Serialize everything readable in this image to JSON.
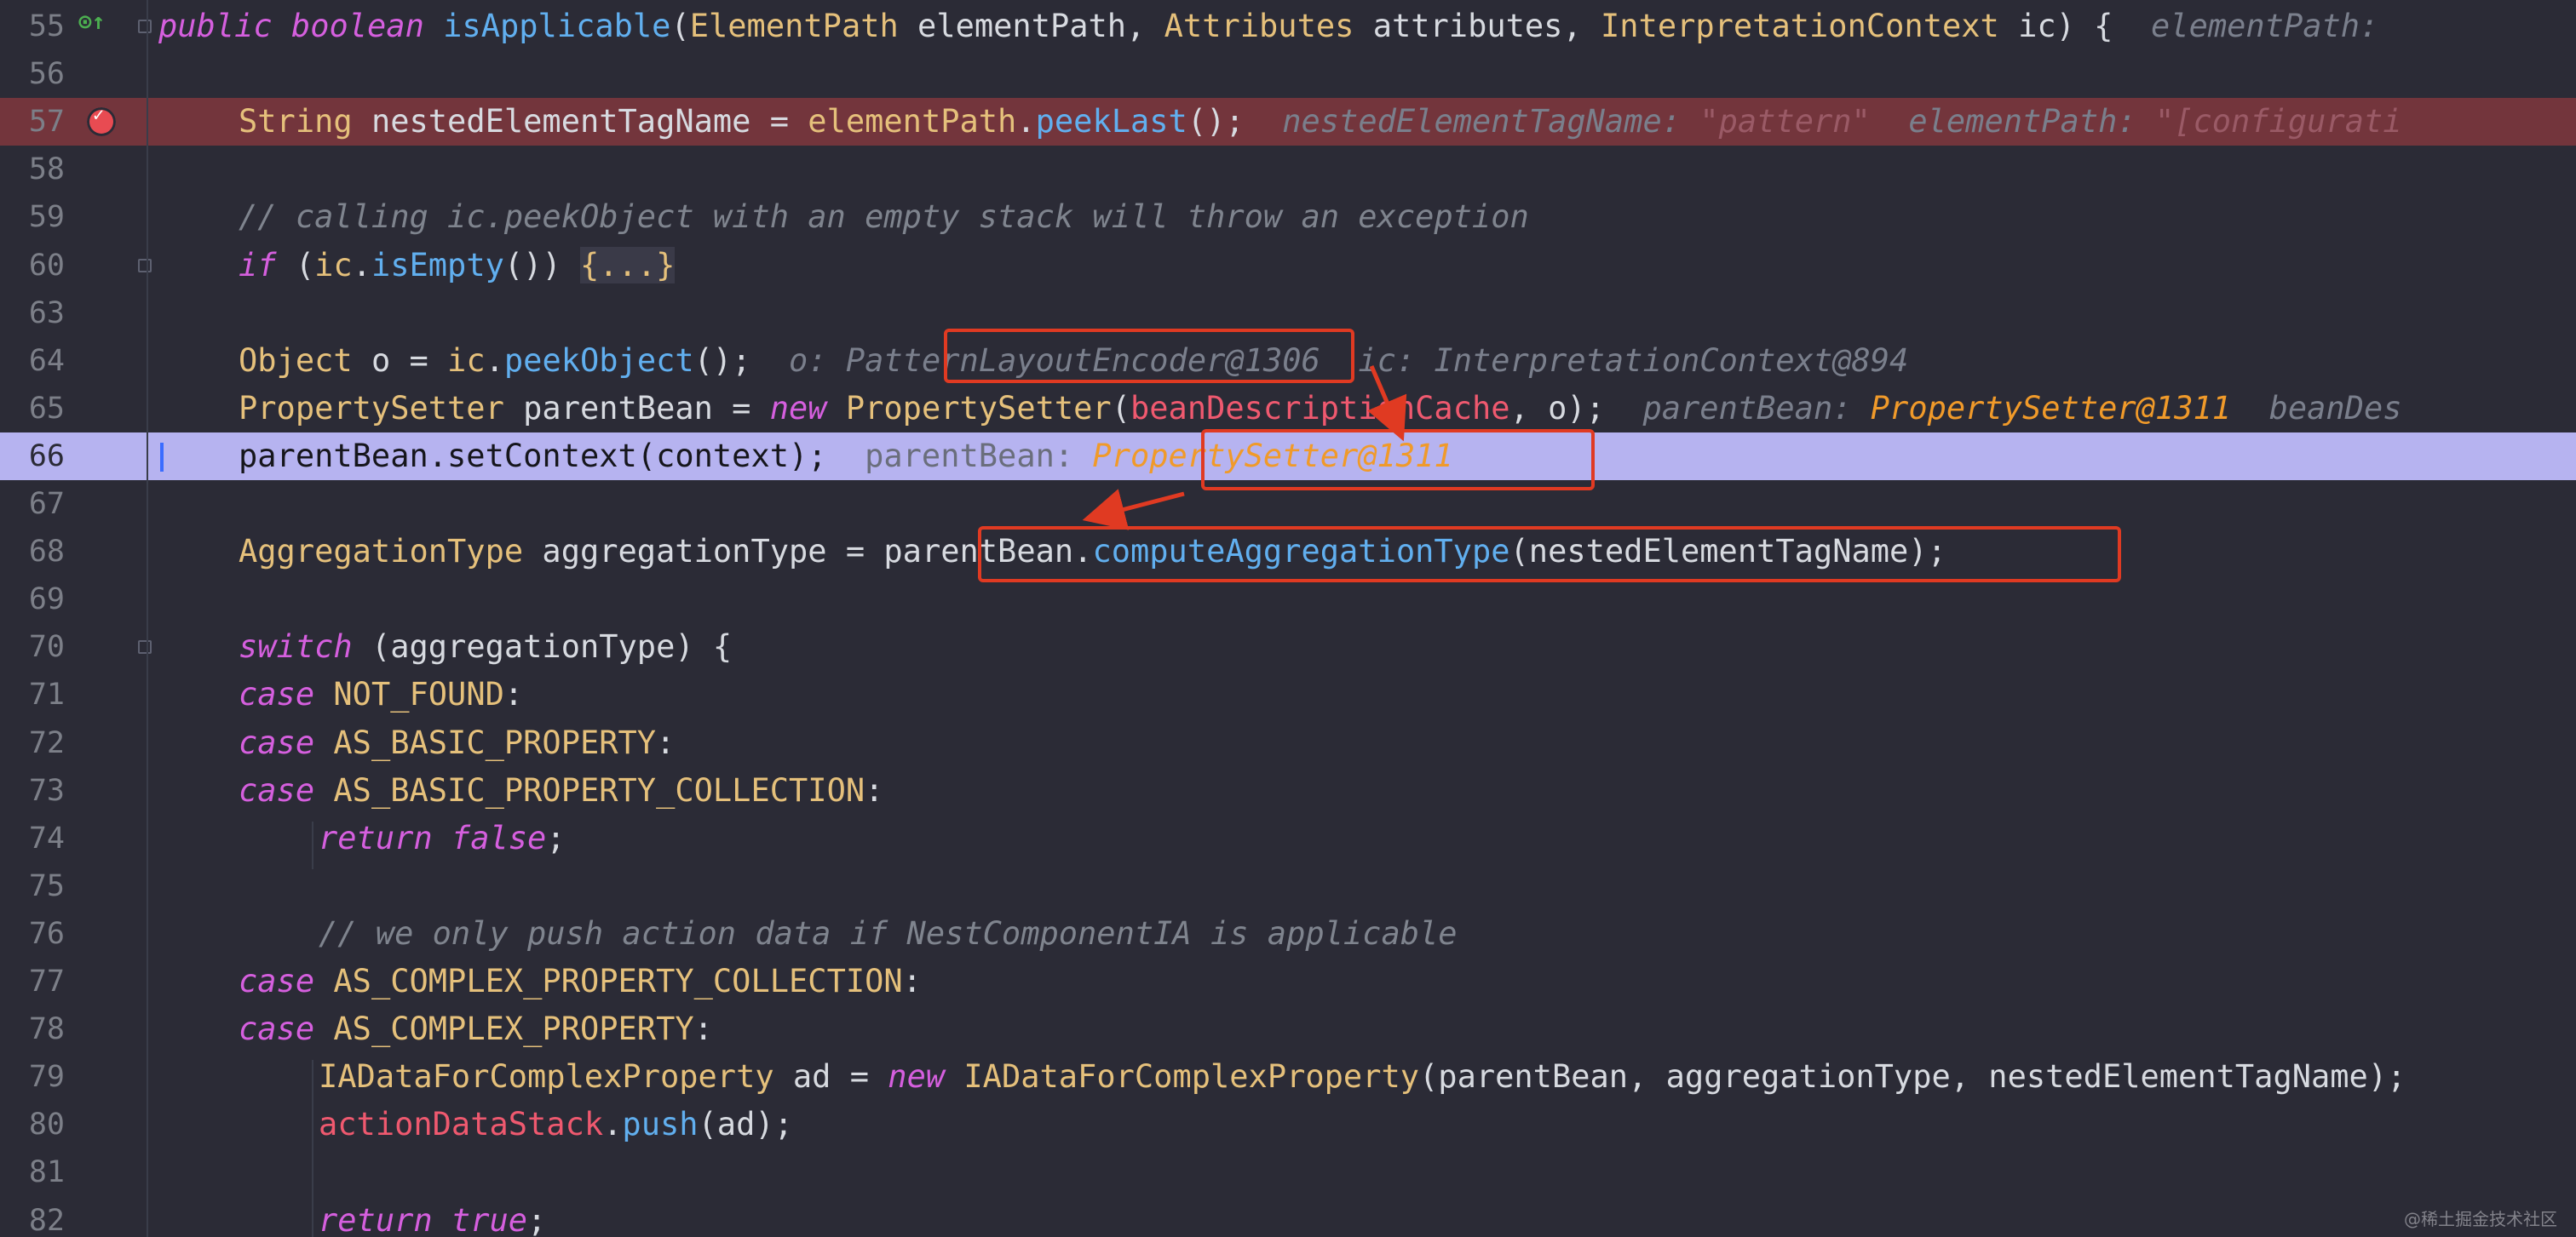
{
  "editor": {
    "lines": [
      {
        "num": "55",
        "state": "normal",
        "tokens": [
          [
            "kw",
            "public boolean "
          ],
          [
            "fn",
            "isApplicable"
          ],
          [
            "plain",
            "("
          ],
          [
            "ty",
            "ElementPath "
          ],
          [
            "plain",
            "elementPath, "
          ],
          [
            "ty",
            "Attributes "
          ],
          [
            "plain",
            "attributes, "
          ],
          [
            "ty",
            "InterpretationContext "
          ],
          [
            "plain",
            "ic) {  "
          ],
          [
            "hint",
            "elementPath: "
          ]
        ]
      },
      {
        "num": "56",
        "state": "normal",
        "tokens": []
      },
      {
        "num": "57",
        "state": "breakpoint",
        "tokens": [
          [
            "ty",
            "String "
          ],
          [
            "plain",
            "nestedElementTagName = "
          ],
          [
            "ty",
            "elementPath"
          ],
          [
            "plain",
            "."
          ],
          [
            "fn",
            "peekLast"
          ],
          [
            "plain",
            "();  "
          ],
          [
            "hint",
            "nestedElementTagName: "
          ],
          [
            "hstr",
            "\"pattern\""
          ],
          [
            "hint",
            "  elementPath: "
          ],
          [
            "hstr",
            "\"[configurati"
          ]
        ]
      },
      {
        "num": "58",
        "state": "normal",
        "tokens": []
      },
      {
        "num": "59",
        "state": "normal",
        "tokens": [
          [
            "cm",
            "// calling ic.peekObject with an empty stack will throw an exception"
          ]
        ]
      },
      {
        "num": "60",
        "state": "normal",
        "tokens": [
          [
            "kw",
            "if "
          ],
          [
            "plain",
            "("
          ],
          [
            "ty",
            "ic"
          ],
          [
            "plain",
            "."
          ],
          [
            "fn",
            "isEmpty"
          ],
          [
            "plain",
            "()) "
          ],
          [
            "fold",
            "{...}"
          ]
        ]
      },
      {
        "num": "63",
        "state": "normal",
        "tokens": []
      },
      {
        "num": "64",
        "state": "normal",
        "tokens": [
          [
            "ty",
            "Object "
          ],
          [
            "plain",
            "o = "
          ],
          [
            "ty",
            "ic"
          ],
          [
            "plain",
            "."
          ],
          [
            "fn",
            "peekObject"
          ],
          [
            "plain",
            "();  "
          ],
          [
            "hint",
            "o: PatternLayoutEncoder@1306  ic: InterpretationContext@894"
          ]
        ]
      },
      {
        "num": "65",
        "state": "normal",
        "tokens": [
          [
            "ty",
            "PropertySetter "
          ],
          [
            "plain",
            "parentBean = "
          ],
          [
            "kw",
            "new "
          ],
          [
            "ty",
            "PropertySetter"
          ],
          [
            "plain",
            "("
          ],
          [
            "fld",
            "beanDescriptionCache"
          ],
          [
            "plain",
            ", o);  "
          ],
          [
            "hint",
            "parentBean: "
          ],
          [
            "hobj",
            "PropertySetter@1311"
          ],
          [
            "hint",
            "  beanDes"
          ]
        ]
      },
      {
        "num": "66",
        "state": "exec",
        "tokens": [
          [
            "plain",
            "parentBean.setContext(context);  "
          ],
          [
            "hint-exec",
            "parentBean: "
          ],
          [
            "hobj",
            "PropertySetter@1311"
          ]
        ]
      },
      {
        "num": "67",
        "state": "normal",
        "tokens": []
      },
      {
        "num": "68",
        "state": "normal",
        "tokens": [
          [
            "ty",
            "AggregationType "
          ],
          [
            "plain",
            "aggregationType = parentBean."
          ],
          [
            "fn",
            "computeAggregationType"
          ],
          [
            "plain",
            "(nestedElementTagName);"
          ]
        ]
      },
      {
        "num": "69",
        "state": "normal",
        "tokens": []
      },
      {
        "num": "70",
        "state": "normal",
        "tokens": [
          [
            "kw",
            "switch "
          ],
          [
            "plain",
            "(aggregationType) {"
          ]
        ]
      },
      {
        "num": "71",
        "state": "normal",
        "tokens": [
          [
            "kw",
            "case "
          ],
          [
            "ty",
            "NOT_FOUND"
          ],
          [
            "plain",
            ":"
          ]
        ]
      },
      {
        "num": "72",
        "state": "normal",
        "tokens": [
          [
            "kw",
            "case "
          ],
          [
            "ty",
            "AS_BASIC_PROPERTY"
          ],
          [
            "plain",
            ":"
          ]
        ]
      },
      {
        "num": "73",
        "state": "normal",
        "tokens": [
          [
            "kw",
            "case "
          ],
          [
            "ty",
            "AS_BASIC_PROPERTY_COLLECTION"
          ],
          [
            "plain",
            ":"
          ]
        ]
      },
      {
        "num": "74",
        "state": "normal",
        "indent": 1,
        "tokens": [
          [
            "kw",
            "return false"
          ],
          [
            "plain",
            ";"
          ]
        ]
      },
      {
        "num": "75",
        "state": "normal",
        "tokens": []
      },
      {
        "num": "76",
        "state": "normal",
        "indent": 1,
        "tokens": [
          [
            "cm",
            "// we only push action data if NestComponentIA is applicable"
          ]
        ]
      },
      {
        "num": "77",
        "state": "normal",
        "tokens": [
          [
            "kw",
            "case "
          ],
          [
            "ty",
            "AS_COMPLEX_PROPERTY_COLLECTION"
          ],
          [
            "plain",
            ":"
          ]
        ]
      },
      {
        "num": "78",
        "state": "normal",
        "tokens": [
          [
            "kw",
            "case "
          ],
          [
            "ty",
            "AS_COMPLEX_PROPERTY"
          ],
          [
            "plain",
            ":"
          ]
        ]
      },
      {
        "num": "79",
        "state": "normal",
        "indent": 1,
        "tokens": [
          [
            "ty",
            "IADataForComplexProperty "
          ],
          [
            "plain",
            "ad = "
          ],
          [
            "kw",
            "new "
          ],
          [
            "ty",
            "IADataForComplexProperty"
          ],
          [
            "plain",
            "(parentBean, aggregationType, nestedElementTagName);"
          ]
        ]
      },
      {
        "num": "80",
        "state": "normal",
        "indent": 1,
        "tokens": [
          [
            "fld",
            "actionDataStack"
          ],
          [
            "plain",
            "."
          ],
          [
            "fn",
            "push"
          ],
          [
            "plain",
            "(ad);"
          ]
        ]
      },
      {
        "num": "81",
        "state": "normal",
        "tokens": []
      },
      {
        "num": "82",
        "state": "normal",
        "indent": 1,
        "tokens": [
          [
            "kw",
            "return true"
          ],
          [
            "plain",
            ";"
          ]
        ]
      }
    ],
    "top_line_base_indent_note": "line 55 is at method indentation level"
  },
  "icons": {
    "breakpoint": "breakpoint-icon",
    "override": "override-marker-icon",
    "fold": "fold-marker-icon"
  },
  "colors": {
    "background": "#2b2b36",
    "exec_line": "#b6b3f0",
    "breakpoint_line": "#73353c",
    "annotation_red": "#e03a22"
  },
  "watermark": "@稀土掘金技术社区"
}
